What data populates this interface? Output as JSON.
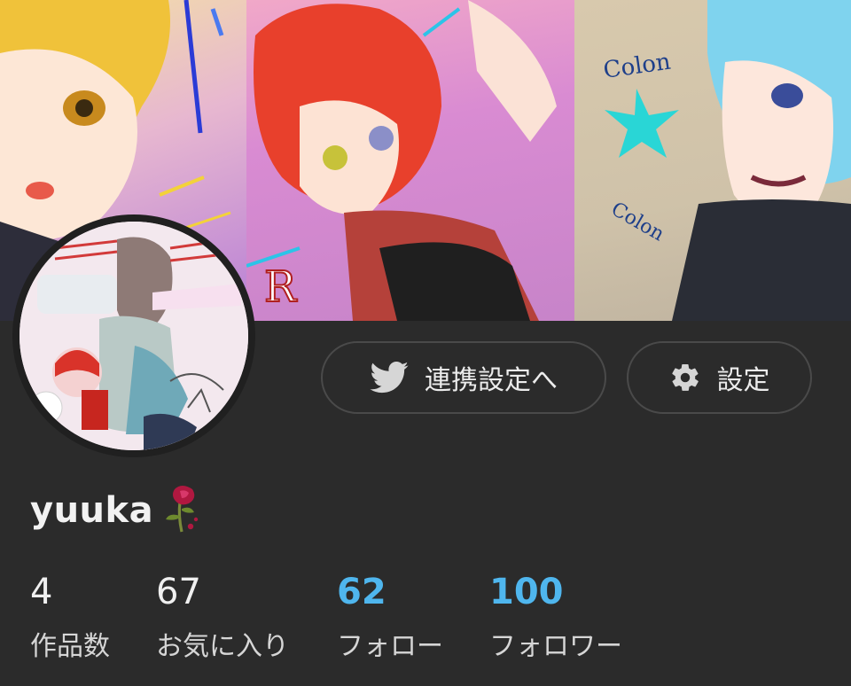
{
  "profile": {
    "username": "yuuka",
    "username_icon": "rose-icon"
  },
  "buttons": {
    "twitter_link_label": "連携設定へ",
    "twitter_icon": "twitter-bird-icon",
    "settings_label": "設定",
    "settings_icon": "gear-icon"
  },
  "stats": [
    {
      "value": "4",
      "label": "作品数"
    },
    {
      "value": "67",
      "label": "お気に入り"
    },
    {
      "value": "62",
      "label": "フォロー"
    },
    {
      "value": "100",
      "label": "フォロワー"
    }
  ],
  "colors": {
    "background": "#2b2b2b",
    "link_blue": "#4fb6ee",
    "button_border": "#4a4a4a"
  }
}
